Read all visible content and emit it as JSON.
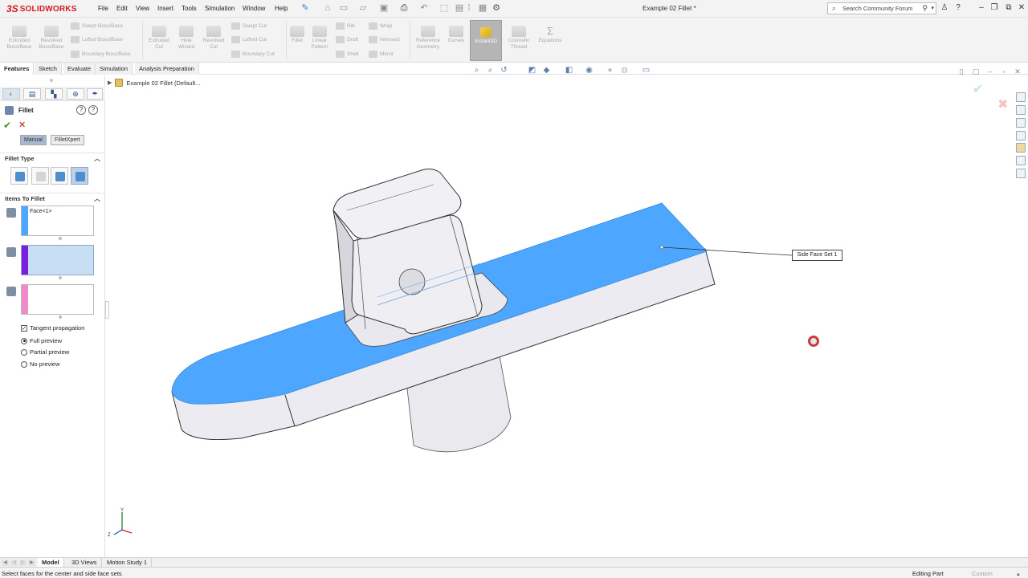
{
  "app": {
    "brand": "SOLIDWORKS",
    "document_title": "Example 02 Fillet *",
    "menu": [
      "File",
      "Edit",
      "View",
      "Insert",
      "Tools",
      "Simulation",
      "Window",
      "Help"
    ],
    "search_placeholder": "Search Community Forum"
  },
  "ribbon": {
    "extruded_boss": "Extruded Boss/Base",
    "revolved_boss": "Revolved Boss/Base",
    "swept_boss": "Swept Boss/Base",
    "lofted_boss": "Lofted Boss/Base",
    "boundary_boss": "Boundary Boss/Base",
    "extruded_cut": "Extruded Cut",
    "hole_wizard": "Hole Wizard",
    "revolved_cut": "Revolved Cut",
    "swept_cut": "Swept Cut",
    "lofted_cut": "Lofted Cut",
    "boundary_cut": "Boundary Cut",
    "fillet": "Fillet",
    "linear_pattern": "Linear Pattern",
    "rib": "Rib",
    "draft": "Draft",
    "shell": "Shell",
    "wrap": "Wrap",
    "intersect": "Intersect",
    "mirror": "Mirror",
    "reference_geometry": "Reference Geometry",
    "curves": "Curves",
    "instant3d": "Instant3D",
    "cosmetic_thread": "Cosmetic Thread",
    "equations": "Equations"
  },
  "command_tabs": [
    "Features",
    "Sketch",
    "Evaluate",
    "Simulation",
    "Analysis Preparation"
  ],
  "property_manager": {
    "title": "Fillet",
    "mode_manual": "Manual",
    "mode_filletxpert": "FilletXpert",
    "fillet_type_header": "Fillet Type",
    "items_header": "Items To Fillet",
    "selection_1": "Face<1>",
    "tangent_propagation": "Tangent propagation",
    "full_preview": "Full preview",
    "partial_preview": "Partial preview",
    "no_preview": "No preview"
  },
  "graphics": {
    "tree_part": "Example 02 Fillet  (Default...",
    "callout": "Side Face Set 1"
  },
  "bottom_tabs": [
    "Model",
    "3D Views",
    "Motion Study 1"
  ],
  "status": {
    "message": "Select faces for the center and side face sets",
    "mode": "Editing Part",
    "units": "Custom"
  },
  "colors": {
    "selection_blue": "#4da6ff",
    "accent_red": "#d71920",
    "selection_purple": "#7a1fe0",
    "selection_pink": "#f08ac8"
  }
}
